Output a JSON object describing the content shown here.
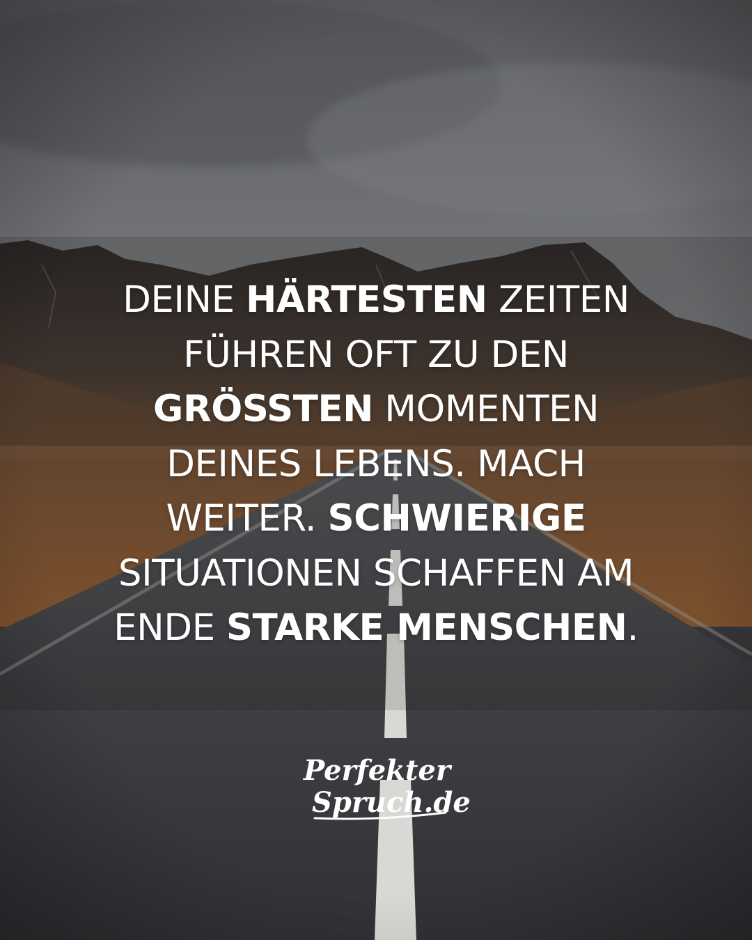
{
  "quote": {
    "lines": [
      [
        {
          "text": "Deine ",
          "bold": false
        },
        {
          "text": "härtesten",
          "bold": true
        },
        {
          "text": " Zeiten",
          "bold": false
        }
      ],
      [
        {
          "text": "führen oft zu den",
          "bold": false
        }
      ],
      [
        {
          "text": "größten",
          "bold": true
        },
        {
          "text": " Momenten",
          "bold": false
        }
      ],
      [
        {
          "text": "deines Lebens. Mach",
          "bold": false
        }
      ],
      [
        {
          "text": "weiter. ",
          "bold": false
        },
        {
          "text": "Schwierige",
          "bold": true
        }
      ],
      [
        {
          "text": "Situationen schaffen am",
          "bold": false
        }
      ],
      [
        {
          "text": "Ende ",
          "bold": false
        },
        {
          "text": "starke Menschen",
          "bold": true
        },
        {
          "text": ".",
          "bold": false
        }
      ]
    ]
  },
  "logo": {
    "line1": "Perfekter",
    "line2": "Spruch.de"
  },
  "colors": {
    "text": "#ffffff",
    "sky": "#6a6d70",
    "mountain": "#3a3431",
    "grass": "#8a5a33",
    "road": "#3b3d40",
    "lane_marking": "#d8d8d4"
  }
}
